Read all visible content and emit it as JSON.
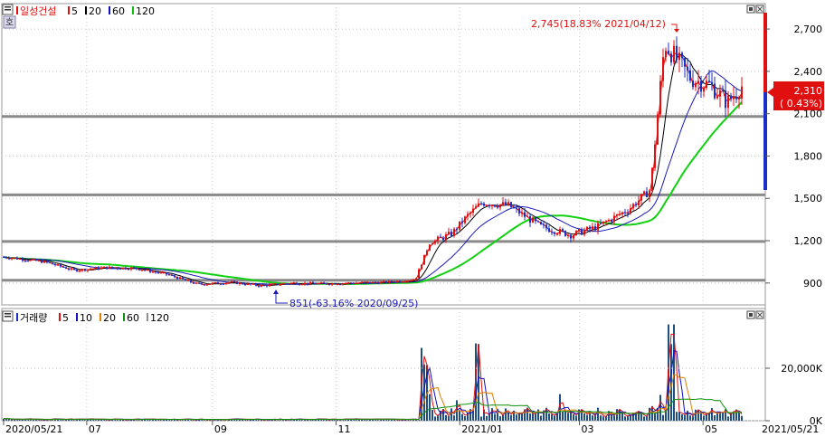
{
  "price_panel": {
    "legend": {
      "name": "일성건설",
      "items": [
        {
          "label": "5",
          "color": "#e01010"
        },
        {
          "label": "20",
          "color": "#000000"
        },
        {
          "label": "60",
          "color": "#1010c0"
        },
        {
          "label": "120",
          "color": "#10c010"
        }
      ]
    },
    "corner_glyph": "호",
    "y_ticks": [
      "2,700",
      "2,400",
      "2,100",
      "1,800",
      "1,500",
      "1,200",
      "900"
    ],
    "current_price": "2,310",
    "current_change": "( 0.43%)",
    "high_annotation": "2,745(18.83% 2021/04/12)",
    "low_annotation": "851(-63.16% 2020/09/25)"
  },
  "volume_panel": {
    "legend": {
      "name": "거래량",
      "items": [
        {
          "label": "5",
          "color": "#e01010"
        },
        {
          "label": "10",
          "color": "#1010c0"
        },
        {
          "label": "20",
          "color": "#e08000"
        },
        {
          "label": "60",
          "color": "#109010"
        },
        {
          "label": "120",
          "color": "#909090"
        }
      ]
    },
    "y_ticks": [
      "20,000K",
      "0K"
    ]
  },
  "x_axis": {
    "ticks": [
      "2020/05/21",
      "07",
      "09",
      "11",
      "2021/01",
      "03",
      "05"
    ],
    "end_label": "2021/05/21"
  },
  "chart_data": {
    "type": "candlestick",
    "y_range": [
      745,
      2880
    ],
    "horizontal_levels": [
      2080,
      1525,
      1195,
      920
    ],
    "price_series": [
      {
        "date": "2020/05/21",
        "close": 1085
      },
      {
        "date": "2020/06/10",
        "close": 1050
      },
      {
        "date": "2020/06/25",
        "close": 990
      },
      {
        "date": "2020/07/10",
        "close": 1010
      },
      {
        "date": "2020/07/25",
        "close": 1005
      },
      {
        "date": "2020/08/10",
        "close": 960
      },
      {
        "date": "2020/08/25",
        "close": 890
      },
      {
        "date": "2020/09/10",
        "close": 905
      },
      {
        "date": "2020/09/25",
        "close": 880
      },
      {
        "date": "2020/10/10",
        "close": 900
      },
      {
        "date": "2020/10/25",
        "close": 895
      },
      {
        "date": "2020/11/10",
        "close": 900
      },
      {
        "date": "2020/11/25",
        "close": 905
      },
      {
        "date": "2020/12/10",
        "close": 925
      },
      {
        "date": "2020/12/17",
        "close": 1180
      },
      {
        "date": "2020/12/28",
        "close": 1250
      },
      {
        "date": "2021/01/05",
        "close": 1380
      },
      {
        "date": "2021/01/12",
        "close": 1470
      },
      {
        "date": "2021/01/25",
        "close": 1450
      },
      {
        "date": "2021/02/10",
        "close": 1300
      },
      {
        "date": "2021/02/25",
        "close": 1240
      },
      {
        "date": "2021/03/10",
        "close": 1300
      },
      {
        "date": "2021/03/25",
        "close": 1420
      },
      {
        "date": "2021/04/05",
        "close": 1560
      },
      {
        "date": "2021/04/12",
        "close": 2600
      },
      {
        "date": "2021/04/25",
        "close": 2350
      },
      {
        "date": "2021/05/05",
        "close": 2300
      },
      {
        "date": "2021/05/13",
        "close": 2180
      },
      {
        "date": "2021/05/21",
        "close": 2310
      }
    ],
    "high": {
      "value": 2745,
      "date": "2021/04/12"
    },
    "low": {
      "value": 851,
      "date": "2020/09/25"
    },
    "volume_y_range": [
      0,
      40000
    ]
  }
}
